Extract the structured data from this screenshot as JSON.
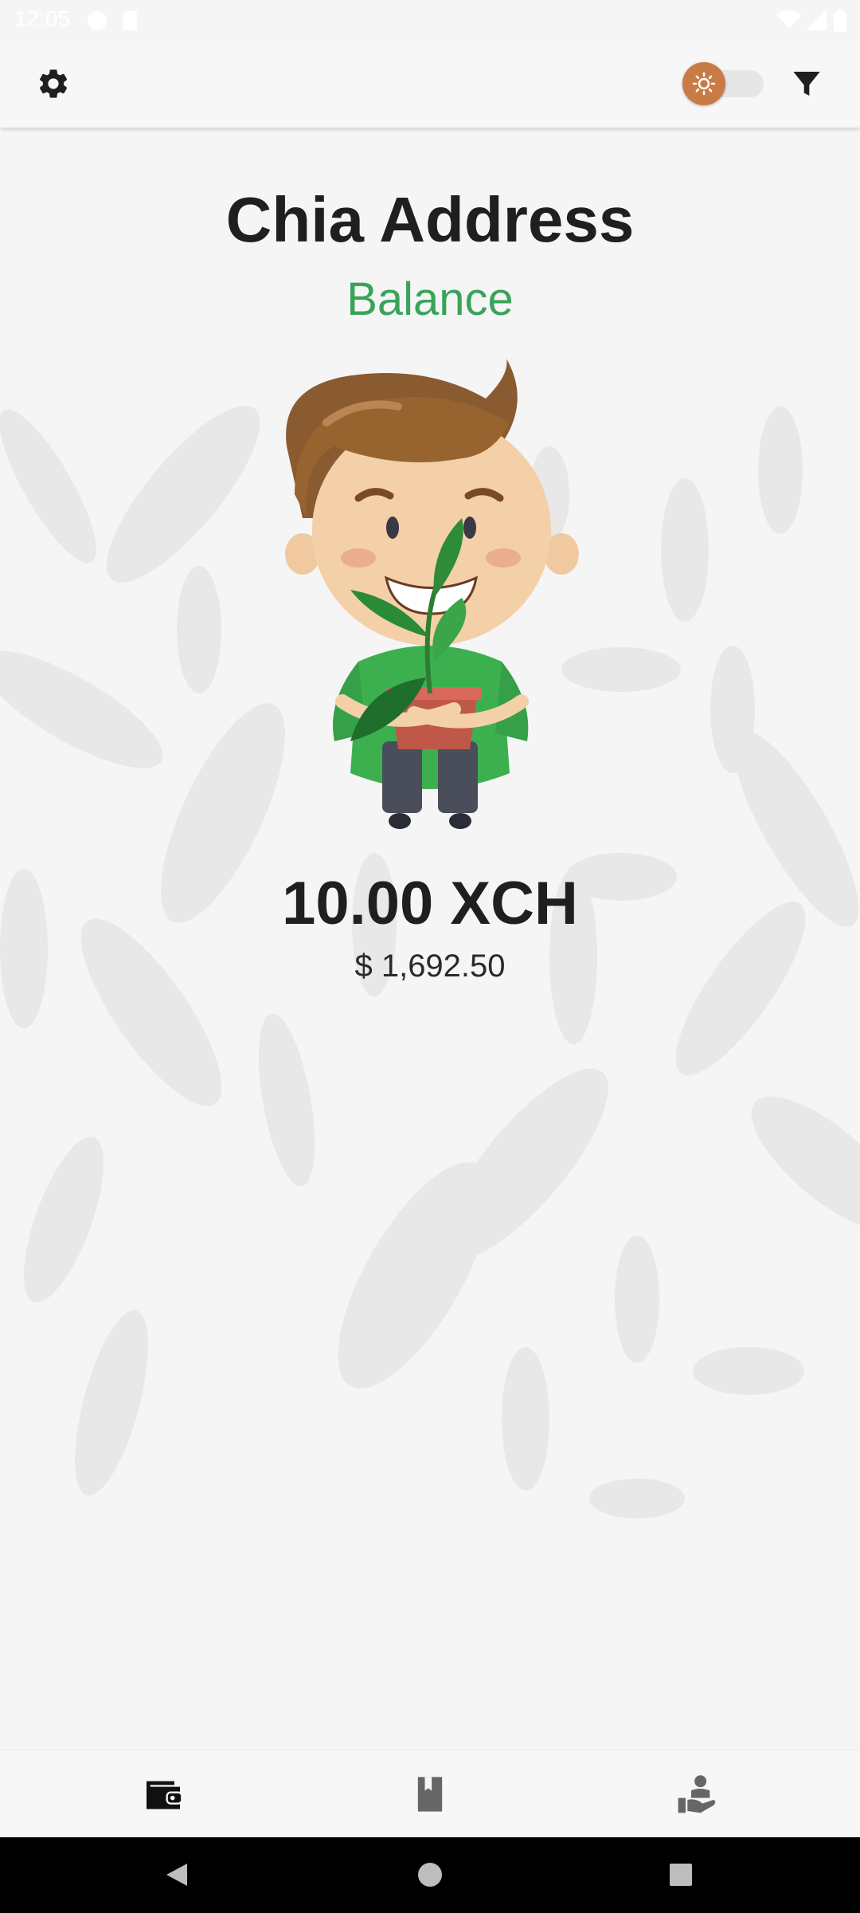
{
  "status_bar": {
    "time": "12:05"
  },
  "app_bar": {
    "settings_icon": "gear-icon",
    "theme_toggle_icon": "sun-icon",
    "filter_icon": "filter-icon"
  },
  "main": {
    "title": "Chia Address",
    "subtitle": "Balance",
    "amount": "10.00 XCH",
    "fiat_value": "$  1,692.50"
  },
  "bottom_nav": {
    "items": [
      {
        "icon": "wallet-icon",
        "active": true
      },
      {
        "icon": "bookmark-icon",
        "active": false
      },
      {
        "icon": "support-hand-icon",
        "active": false
      }
    ]
  },
  "colors": {
    "accent_green": "#3aa35a",
    "toggle_thumb": "#c97b45",
    "background": "#f5f5f5"
  }
}
